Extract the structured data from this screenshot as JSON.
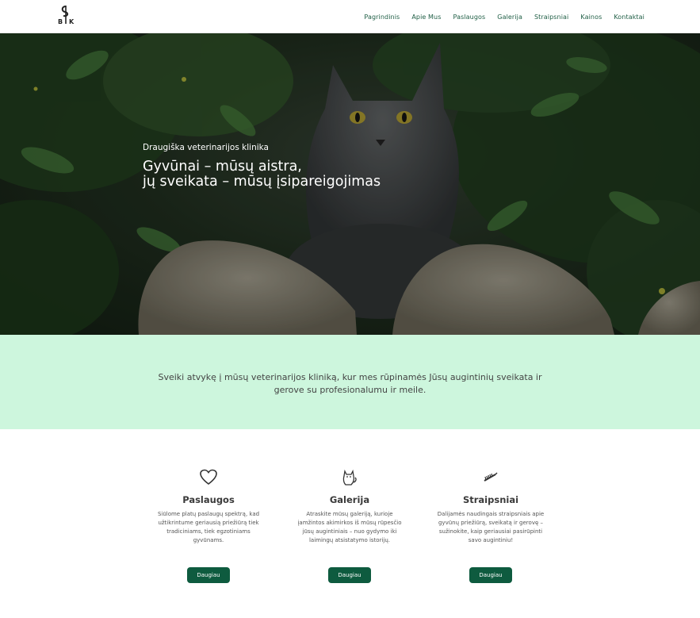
{
  "header": {
    "logo_alt": "BVK",
    "nav": [
      {
        "label": "Pagrindinis"
      },
      {
        "label": "Apie Mus"
      },
      {
        "label": "Paslaugos"
      },
      {
        "label": "Galerija"
      },
      {
        "label": "Straipsniai"
      },
      {
        "label": "Kainos"
      },
      {
        "label": "Kontaktai"
      }
    ]
  },
  "hero": {
    "subtitle": "Draugiška veterinarijos klinika",
    "title_line1": "Gyvūnai – mūsų aistra,",
    "title_line2": "jų sveikata – mūsų įsipareigojimas"
  },
  "intro": {
    "text": "Sveiki atvykę į mūsų veterinarijos kliniką, kur mes rūpinamės Jūsų augintinių sveikata ir gerove su profesionalumu ir meile."
  },
  "cards": [
    {
      "icon": "heart-icon",
      "title": "Paslaugos",
      "text": "Siūlome platų paslaugų spektrą, kad užtikrintume geriausią priežiūrą tiek tradiciniams, tiek egzotiniams gyvūnams.",
      "button": "Daugiau"
    },
    {
      "icon": "cat-icon",
      "title": "Galerija",
      "text": "Atraskite mūsų galeriją, kurioje įamžintos akimirkos iš mūsų rūpesčio jūsų augintiniais – nuo gydymo iki laimingų atsistatymo istorijų.",
      "button": "Daugiau"
    },
    {
      "icon": "comb-icon",
      "title": "Straipsniai",
      "text": "Dalijamės naudingais straipsniais apie gyvūnų priežiūrą, sveikatą ir gerovę – sužinokite, kaip geriausiai pasirūpinti savo augintiniu!",
      "button": "Daugiau"
    }
  ],
  "colors": {
    "accent": "#0e5b3f",
    "nav_text": "#1f5e45",
    "intro_bg": "#cdf6dd"
  }
}
